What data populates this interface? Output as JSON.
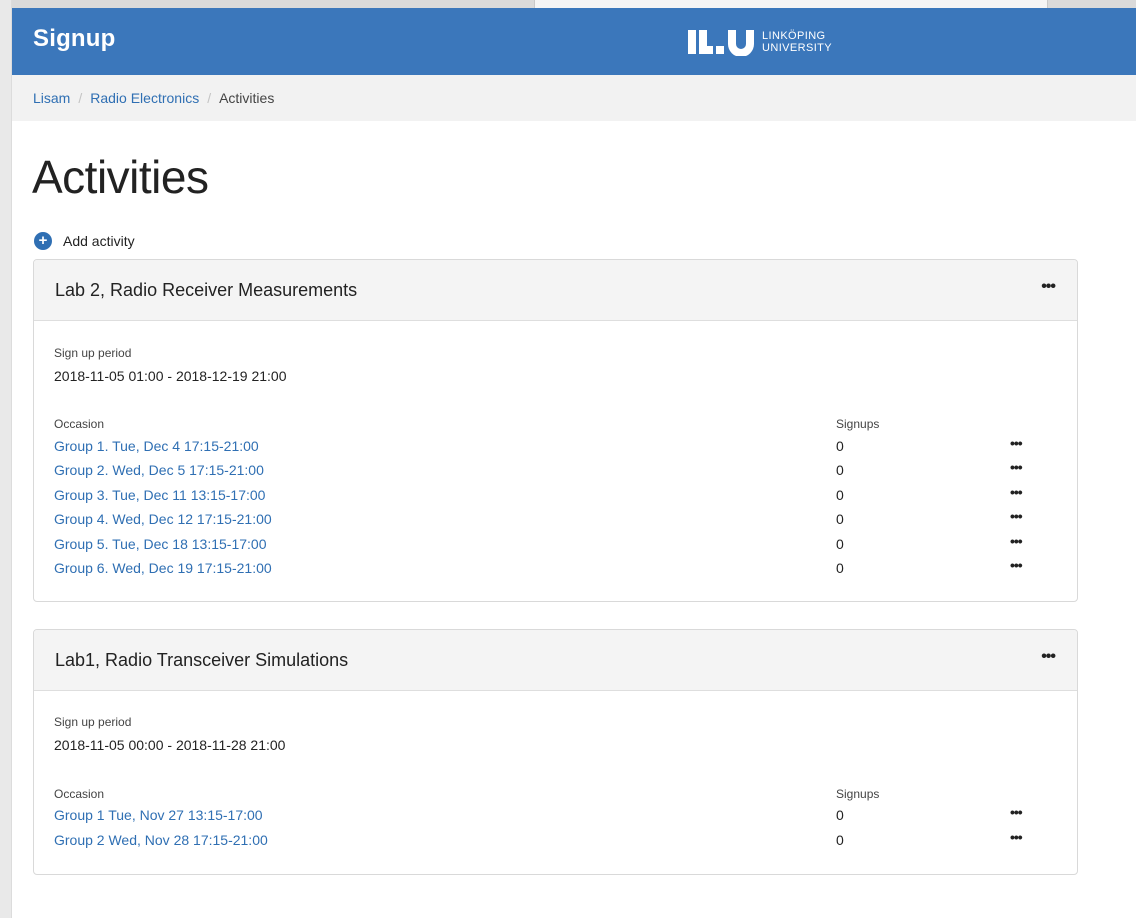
{
  "app": {
    "title": "Signup"
  },
  "logo": {
    "line1": "LINKÖPING",
    "line2": "UNIVERSITY",
    "color": "#ffffff"
  },
  "colors": {
    "header": "#3b77bb",
    "link": "#2f6fb3"
  },
  "breadcrumb": {
    "items": [
      "Lisam",
      "Radio Electronics"
    ],
    "current": "Activities"
  },
  "page": {
    "title": "Activities",
    "add_label": "Add activity"
  },
  "activities": [
    {
      "title": "Lab 2, Radio Receiver Measurements",
      "menu": "•••",
      "period_label": "Sign up period",
      "period": "2018-11-05 01:00 - 2018-12-19 21:00",
      "occasion_header": "Occasion",
      "signups_header": "Signups",
      "occasions": [
        {
          "name": "Group 1. Tue, Dec 4 17:15-21:00",
          "signups": "0",
          "menu": "•••"
        },
        {
          "name": "Group 2. Wed, Dec 5 17:15-21:00",
          "signups": "0",
          "menu": "•••"
        },
        {
          "name": "Group 3. Tue, Dec 11 13:15-17:00",
          "signups": "0",
          "menu": "•••"
        },
        {
          "name": "Group 4. Wed, Dec 12 17:15-21:00",
          "signups": "0",
          "menu": "•••"
        },
        {
          "name": "Group 5. Tue, Dec 18 13:15-17:00",
          "signups": "0",
          "menu": "•••"
        },
        {
          "name": "Group 6. Wed, Dec 19 17:15-21:00",
          "signups": "0",
          "menu": "•••"
        }
      ]
    },
    {
      "title": "Lab1, Radio Transceiver Simulations",
      "menu": "•••",
      "period_label": "Sign up period",
      "period": "2018-11-05 00:00 - 2018-11-28 21:00",
      "occasion_header": "Occasion",
      "signups_header": "Signups",
      "occasions": [
        {
          "name": "Group 1 Tue, Nov 27 13:15-17:00",
          "signups": "0",
          "menu": "•••"
        },
        {
          "name": "Group 2 Wed, Nov 28 17:15-21:00",
          "signups": "0",
          "menu": "•••"
        }
      ]
    }
  ]
}
